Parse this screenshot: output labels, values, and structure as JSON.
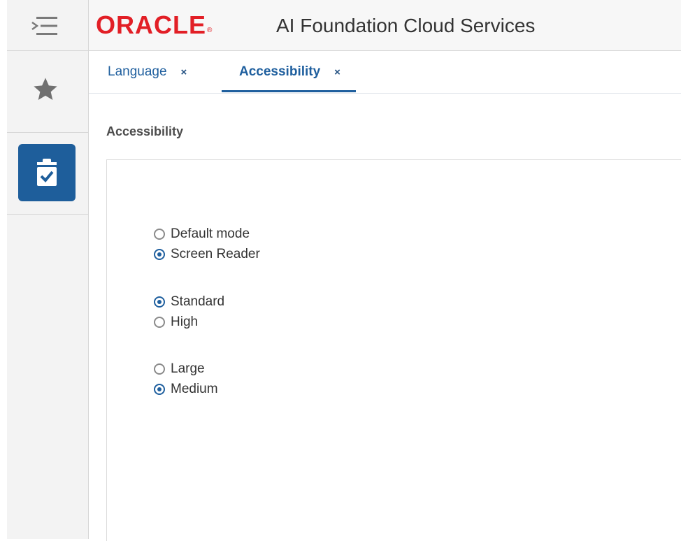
{
  "header": {
    "logo_text": "ORACLE",
    "logo_mark": "®",
    "product_title": "AI Foundation Cloud Services"
  },
  "rail": {
    "menu_icon": "menu-collapse-icon",
    "favorites_icon": "star-icon",
    "tasks_icon": "clipboard-check-icon",
    "accent_color": "#1e5e9b"
  },
  "tabs": [
    {
      "label": "Language",
      "close": "×",
      "active": false
    },
    {
      "label": "Accessibility",
      "close": "×",
      "active": true
    }
  ],
  "content": {
    "section_title": "Accessibility",
    "groups": [
      {
        "options": [
          {
            "label": "Default mode",
            "selected": false
          },
          {
            "label": "Screen Reader",
            "selected": true
          }
        ]
      },
      {
        "options": [
          {
            "label": "Standard",
            "selected": true
          },
          {
            "label": "High",
            "selected": false
          }
        ]
      },
      {
        "options": [
          {
            "label": "Large",
            "selected": false
          },
          {
            "label": "Medium",
            "selected": true
          }
        ]
      }
    ]
  },
  "colors": {
    "brand_red": "#e21f26",
    "link_blue": "#1f5f9e"
  }
}
